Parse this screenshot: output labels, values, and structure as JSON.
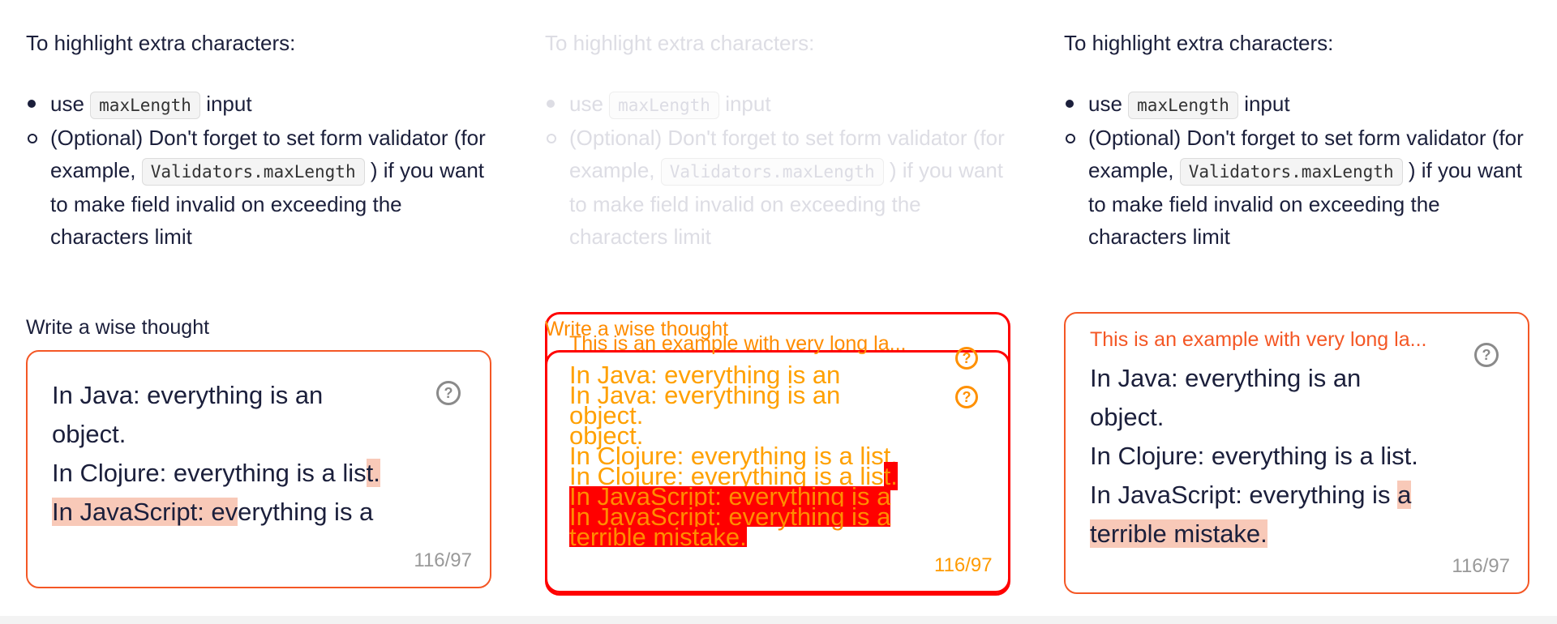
{
  "intro": "To highlight extra characters:",
  "items": {
    "use": "use",
    "maxlength_code": "maxLength",
    "input_word": "input",
    "optional_pre": "(Optional) Don't forget to set form validator (for example,",
    "validators_code": "Validators.maxLength",
    "optional_post": ") if you want to make field invalid on exceeding the characters limit"
  },
  "field": {
    "label": "Write a wise thought",
    "float_label": "This is an example with very long la...",
    "line1": "In Java: everything is an",
    "line2": "object.",
    "line3_plain": "In Clojure: everything is a lis",
    "line3_mark": "t.",
    "line4_mark": "In JavaScript: ev",
    "line4_plain": "erything is a",
    "line4_full_plain": "In JavaScript: everything is ",
    "line4_full_mark": "a",
    "line5": "terrible mistake.",
    "counter": "116/97",
    "help_icon_glyph": "?"
  },
  "colors": {
    "accent": "#f45725",
    "highlight": "#f8c9b8",
    "text": "#1b1f3b"
  }
}
